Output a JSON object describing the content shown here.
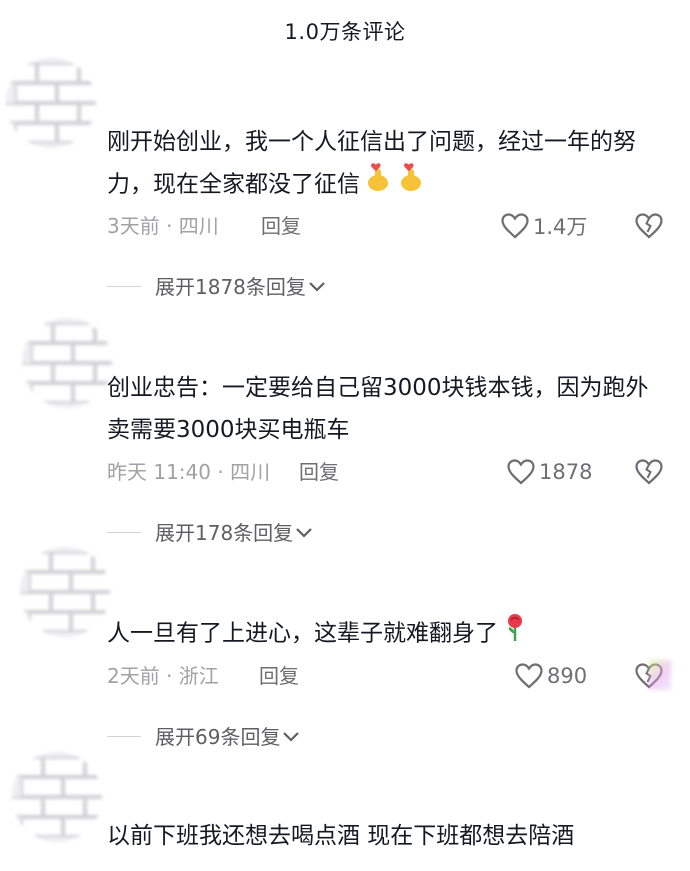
{
  "header": {
    "title": "1.0万条评论"
  },
  "comments": [
    {
      "text": "刚开始创业，我一个人征信出了问题，经过一年的努力，现在全家都没了征信",
      "meta": "3天前 · 四川",
      "reply_label": "回复",
      "likes": "1.4万",
      "expand_label": "展开1878条回复",
      "emoji": [
        "finger-heart-icon",
        "finger-heart-icon"
      ]
    },
    {
      "text": "创业忠告：一定要给自己留3000块钱本钱，因为跑外卖需要3000块买电瓶车",
      "meta": "昨天 11:40 · 四川",
      "reply_label": "回复",
      "likes": "1878",
      "expand_label": "展开178条回复"
    },
    {
      "text": "人一旦有了上进心，这辈子就难翻身了",
      "meta": "2天前 · 浙江",
      "reply_label": "回复",
      "likes": "890",
      "expand_label": "展开69条回复",
      "emoji": [
        "rose-icon"
      ]
    },
    {
      "text": "以前下班我还想去喝点酒 现在下班都想去陪酒"
    }
  ],
  "colors": {
    "text_primary": "#161823",
    "text_meta": "#a1a1a6",
    "text_action": "#6e6e73",
    "avatar_brick": "#e4e4e6"
  }
}
